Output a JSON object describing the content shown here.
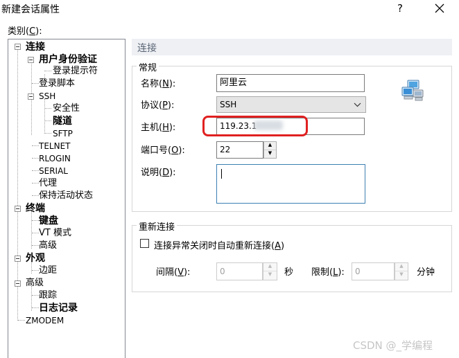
{
  "window": {
    "title": "新建会话属性",
    "help_glyph": "?",
    "close_glyph": "✕"
  },
  "category": {
    "label": "类别(",
    "label_key": "C",
    "label_end": "):"
  },
  "tree": [
    {
      "label": "连接",
      "bold": true
    },
    {
      "label": "用户身份验证",
      "bold": true
    },
    {
      "label": "登录提示符"
    },
    {
      "label": "登录脚本"
    },
    {
      "label": "SSH"
    },
    {
      "label": "安全性"
    },
    {
      "label": "隧道",
      "bold": true
    },
    {
      "label": "SFTP"
    },
    {
      "label": "TELNET"
    },
    {
      "label": "RLOGIN"
    },
    {
      "label": "SERIAL"
    },
    {
      "label": "代理"
    },
    {
      "label": "保持活动状态"
    },
    {
      "label": "终端",
      "bold": true
    },
    {
      "label": "键盘",
      "bold": true
    },
    {
      "label": "VT 模式"
    },
    {
      "label": "高级"
    },
    {
      "label": "外观",
      "bold": true
    },
    {
      "label": "边距"
    },
    {
      "label": "高级"
    },
    {
      "label": "跟踪"
    },
    {
      "label": "日志记录",
      "bold": true
    },
    {
      "label": "ZMODEM"
    }
  ],
  "panel": {
    "header": "连接",
    "general": {
      "title": "常规",
      "name_label": "名称(",
      "name_key": "N",
      "name_end": "):",
      "name_value": "阿里云",
      "protocol_label": "协议(",
      "protocol_key": "P",
      "protocol_end": "):",
      "protocol_value": "SSH",
      "host_label": "主机(",
      "host_key": "H",
      "host_end": "):",
      "host_value": "119.23.1",
      "port_label": "端口号(",
      "port_key": "O",
      "port_end": "):",
      "port_value": "22",
      "desc_label": "说明(",
      "desc_key": "D",
      "desc_end": "):",
      "desc_value": ""
    },
    "reconnect": {
      "title": "重新连接",
      "checkbox_label": "连接异常关闭时自动重新连接(",
      "checkbox_key": "A",
      "checkbox_end": ")",
      "checked": false,
      "interval_label": "间隔(",
      "interval_key": "V",
      "interval_end": "):",
      "interval_value": "0",
      "interval_unit": "秒",
      "limit_label": "限制(",
      "limit_key": "L",
      "limit_end": "):",
      "limit_value": "0",
      "limit_unit": "分钟"
    }
  },
  "icons": {
    "spin_up": "▲",
    "spin_down": "▼",
    "combo_chevron": "chevron-down-icon",
    "network": "network-computers-icon"
  },
  "colors": {
    "highlight_ring": "#e02020",
    "header_bar": "#eef0f4",
    "accent_border": "#3c7fb1"
  },
  "watermark": "CSDN @_学编程"
}
